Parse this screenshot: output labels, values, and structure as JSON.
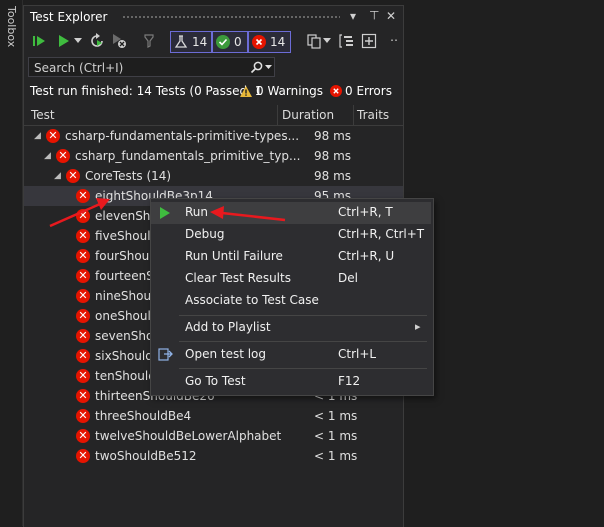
{
  "toolbox": {
    "label": "Toolbox"
  },
  "window": {
    "title": "Test Explorer",
    "dropdown_glyph": "▾",
    "pin_glyph": "⊥",
    "close_glyph": "✕"
  },
  "toolbar": {
    "counters": {
      "total": "14",
      "passed": "0",
      "failed": "14"
    },
    "more_glyph": "‥"
  },
  "search": {
    "placeholder": "Search (Ctrl+I)"
  },
  "status": {
    "summary": "Test run finished: 14 Tests (0 Passed, 1",
    "warnings": "0 Warnings",
    "errors": "0 Errors"
  },
  "columns": {
    "test": "Test",
    "duration": "Duration",
    "traits": "Traits"
  },
  "tree": [
    {
      "name": "csharp-fundamentals-primitive-types...",
      "duration": "98 ms",
      "level": 0,
      "expander": "◢"
    },
    {
      "name": "csharp_fundamentals_primitive_typ...",
      "duration": "98 ms",
      "level": 1,
      "expander": "◢"
    },
    {
      "name": "CoreTests  (14)",
      "duration": "98 ms",
      "level": 2,
      "expander": "◢"
    },
    {
      "name": "eightShouldBe3p14",
      "duration": "95 ms",
      "level": 3,
      "selected": true
    },
    {
      "name": "elevenShou",
      "duration": "",
      "level": 3
    },
    {
      "name": "fiveShould",
      "duration": "",
      "level": 3
    },
    {
      "name": "fourShould",
      "duration": "",
      "level": 3
    },
    {
      "name": "fourteenSh",
      "duration": "",
      "level": 3
    },
    {
      "name": "nineShoul",
      "duration": "",
      "level": 3
    },
    {
      "name": "oneShould",
      "duration": "",
      "level": 3
    },
    {
      "name": "sevenShou",
      "duration": "",
      "level": 3
    },
    {
      "name": "sixShouldE",
      "duration": "",
      "level": 3
    },
    {
      "name": "tenShould",
      "duration": "",
      "level": 3
    },
    {
      "name": "thirteenShouldBe26",
      "duration": "< 1 ms",
      "level": 3
    },
    {
      "name": "threeShouldBe4",
      "duration": "< 1 ms",
      "level": 3
    },
    {
      "name": "twelveShouldBeLowerAlphabet",
      "duration": "< 1 ms",
      "level": 3
    },
    {
      "name": "twoShouldBe512",
      "duration": "< 1 ms",
      "level": 3
    }
  ],
  "context_menu": {
    "items": [
      {
        "label": "Run",
        "shortcut": "Ctrl+R, T",
        "icon": "play-icon",
        "highlighted": true
      },
      {
        "label": "Debug",
        "shortcut": "Ctrl+R, Ctrl+T"
      },
      {
        "label": "Run Until Failure",
        "shortcut": "Ctrl+R, U"
      },
      {
        "label": "Clear Test Results",
        "shortcut": "Del"
      },
      {
        "label": "Associate to Test Case",
        "shortcut": ""
      },
      {
        "label": "Add to Playlist",
        "shortcut": "",
        "submenu": "▸"
      },
      {
        "label": "Open test log",
        "shortcut": "Ctrl+L",
        "icon": "open-log-icon"
      },
      {
        "label": "Go To Test",
        "shortcut": "F12"
      }
    ]
  },
  "colors": {
    "fail": "#e51400",
    "pass": "#3c9a3c",
    "play": "#3fbc3f",
    "annotation_arrow": "#e8191e",
    "counter_border": "#6c6cd6"
  }
}
